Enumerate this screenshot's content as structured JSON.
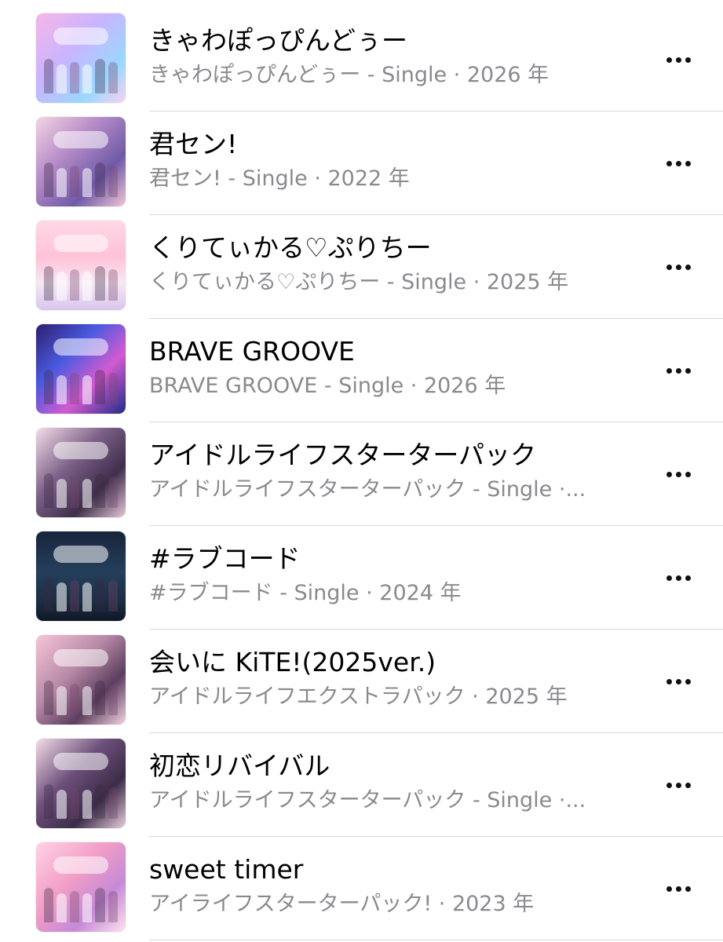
{
  "songs": [
    {
      "title": "きゃわぽっぴんどぅー",
      "subtitle": "きゃわぽっぴんどぅー - Single · 2026 年",
      "artwork": "album-artwork",
      "more_icon": "ellipsis-icon"
    },
    {
      "title": "君セン!",
      "subtitle": "君セン! - Single · 2022 年",
      "artwork": "album-artwork",
      "more_icon": "ellipsis-icon"
    },
    {
      "title": "くりてぃかる♡ぷりちー",
      "subtitle": "くりてぃかる♡ぷりちー - Single · 2025 年",
      "artwork": "album-artwork",
      "more_icon": "ellipsis-icon"
    },
    {
      "title": "BRAVE GROOVE",
      "subtitle": "BRAVE GROOVE - Single · 2026 年",
      "artwork": "album-artwork",
      "more_icon": "ellipsis-icon"
    },
    {
      "title": "アイドルライフスターターパック",
      "subtitle": "アイドルライフスターターパック - Single ·...",
      "artwork": "album-artwork",
      "more_icon": "ellipsis-icon"
    },
    {
      "title": "#ラブコード",
      "subtitle": "#ラブコード - Single · 2024 年",
      "artwork": "album-artwork",
      "more_icon": "ellipsis-icon"
    },
    {
      "title": "会いに KiTE!(2025ver.)",
      "subtitle": "アイドルライフエクストラパック · 2025 年",
      "artwork": "album-artwork",
      "more_icon": "ellipsis-icon"
    },
    {
      "title": "初恋リバイバル",
      "subtitle": "アイドルライフスターターパック - Single ·...",
      "artwork": "album-artwork",
      "more_icon": "ellipsis-icon"
    },
    {
      "title": "sweet timer",
      "subtitle": "アイライフスターターパック! · 2023 年",
      "artwork": "album-artwork",
      "more_icon": "ellipsis-icon"
    }
  ],
  "colors": {
    "title_text": "#000000",
    "subtitle_text": "#8a8a8e",
    "divider": "#d9d9dc",
    "background": "#ffffff"
  }
}
